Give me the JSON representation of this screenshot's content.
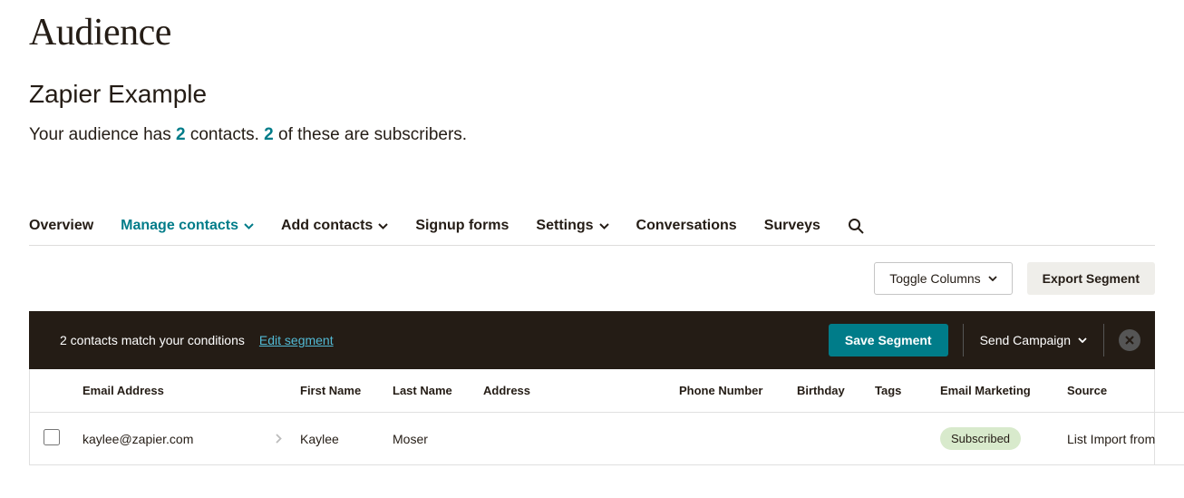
{
  "page": {
    "title": "Audience",
    "subtitle": "Zapier Example",
    "desc_prefix": "Your audience has ",
    "contacts_count": "2",
    "desc_mid": " contacts. ",
    "subscribers_count": "2",
    "desc_suffix": " of these are subscribers."
  },
  "tabs": {
    "overview": "Overview",
    "manage": "Manage contacts",
    "add": "Add contacts",
    "signup": "Signup forms",
    "settings": "Settings",
    "conversations": "Conversations",
    "surveys": "Surveys"
  },
  "toolbar": {
    "toggle_columns": "Toggle Columns",
    "export_segment": "Export Segment"
  },
  "segment": {
    "match_text": "2 contacts match your conditions",
    "edit": "Edit segment",
    "save": "Save Segment",
    "send": "Send Campaign"
  },
  "table": {
    "headers": {
      "email": "Email Address",
      "first_name": "First Name",
      "last_name": "Last Name",
      "address": "Address",
      "phone": "Phone Number",
      "birthday": "Birthday",
      "tags": "Tags",
      "email_marketing": "Email Marketing",
      "source": "Source"
    },
    "rows": [
      {
        "email": "kaylee@zapier.com",
        "first_name": "Kaylee",
        "last_name": "Moser",
        "address": "",
        "phone": "",
        "birthday": "",
        "tags": "",
        "email_marketing": "Subscribed",
        "source": "List Import from"
      }
    ]
  }
}
